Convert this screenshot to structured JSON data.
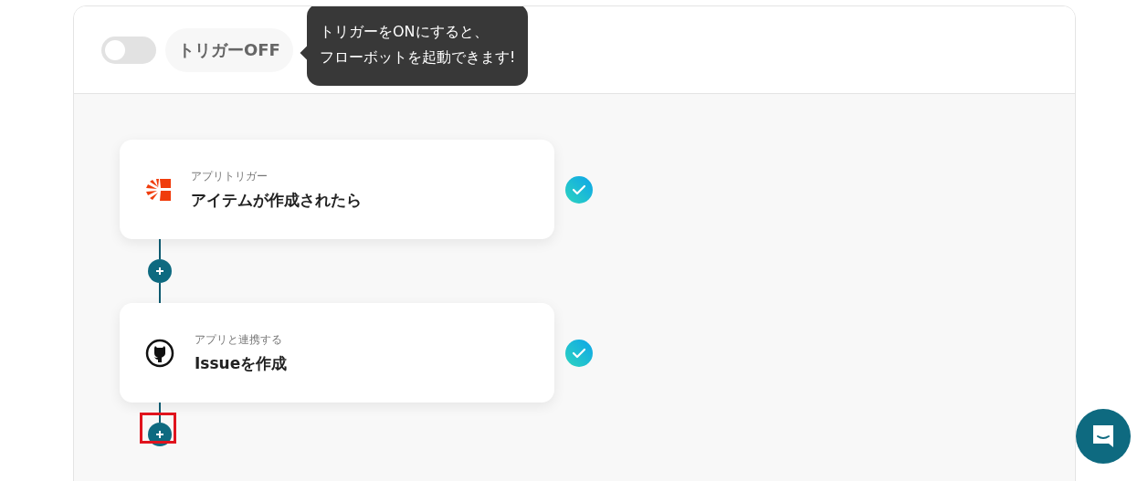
{
  "trigger_toggle": {
    "on": false,
    "label": "トリガーOFF"
  },
  "tooltip": {
    "lines": [
      "トリガーをONにすると、",
      "フローボットを起動できます!"
    ]
  },
  "steps": [
    {
      "kind": "trigger",
      "subtitle": "アプリトリガー",
      "title": "アイテムが作成されたら",
      "done": true
    },
    {
      "kind": "action",
      "subtitle": "アプリと連携する",
      "title": "Issueを作成",
      "done": true
    }
  ],
  "add_buttons": [
    {
      "highlighted": false
    },
    {
      "highlighted": true
    }
  ]
}
